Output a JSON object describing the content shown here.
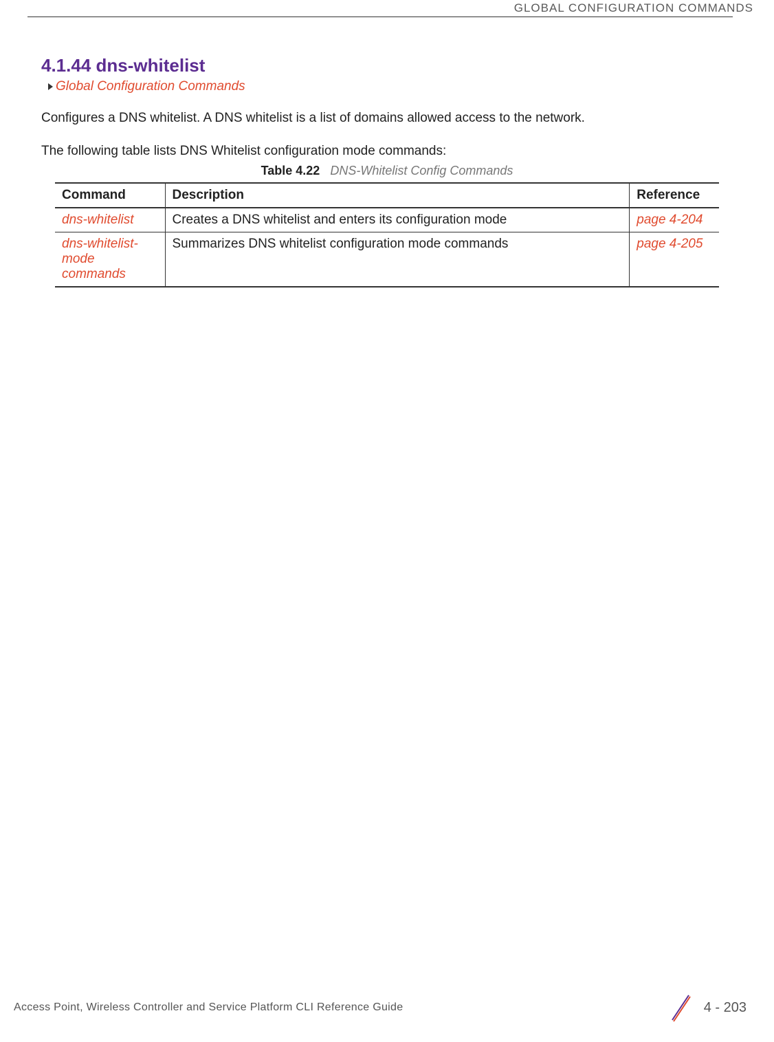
{
  "header": {
    "running_head": "GLOBAL CONFIGURATION COMMANDS"
  },
  "section": {
    "heading": "4.1.44 dns-whitelist",
    "breadcrumb": "Global Configuration Commands",
    "paragraph1": "Configures a DNS whitelist. A DNS whitelist is a list of domains allowed access to the network.",
    "paragraph2": "The following table lists DNS Whitelist configuration mode commands:"
  },
  "table": {
    "caption_label": "Table 4.22",
    "caption_title": "DNS-Whitelist Config Commands",
    "headers": {
      "command": "Command",
      "description": "Description",
      "reference": "Reference"
    },
    "rows": [
      {
        "command": "dns-whitelist",
        "description": "Creates a DNS whitelist and enters its configuration mode",
        "reference": "page 4-204"
      },
      {
        "command": "dns-whitelist-mode commands",
        "description": "Summarizes DNS whitelist configuration mode commands",
        "reference": "page 4-205"
      }
    ]
  },
  "footer": {
    "guide_title": "Access Point, Wireless Controller and Service Platform CLI Reference Guide",
    "page_number": "4 - 203"
  }
}
